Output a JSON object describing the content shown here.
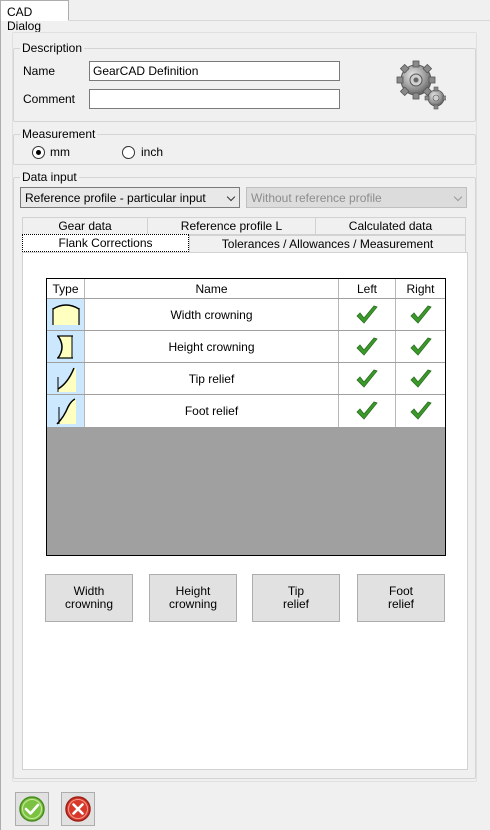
{
  "window": {
    "tab_title": "CAD Dialog"
  },
  "description": {
    "title": "Description",
    "name_label": "Name",
    "name_value": "GearCAD Definition",
    "comment_label": "Comment",
    "comment_value": "",
    "logo_icon": "gears-icon"
  },
  "measurement": {
    "title": "Measurement",
    "options": [
      {
        "label": "mm",
        "checked": true
      },
      {
        "label": "inch",
        "checked": false
      }
    ]
  },
  "data_input": {
    "title": "Data input",
    "profile_select": "Reference profile - particular input",
    "reference_select": "Without reference profile"
  },
  "tabs": {
    "row1": [
      "Gear data",
      "Reference profile L",
      "Calculated data"
    ],
    "row2": [
      "Flank Corrections",
      "Tolerances / Allowances / Measurement"
    ],
    "active": "Flank Corrections"
  },
  "grid": {
    "headers": {
      "type": "Type",
      "name": "Name",
      "left": "Left",
      "right": "Right"
    },
    "rows": [
      {
        "icon": "width-crowning-icon",
        "name": "Width crowning",
        "left": true,
        "right": true
      },
      {
        "icon": "height-crowning-icon",
        "name": "Height crowning",
        "left": true,
        "right": true
      },
      {
        "icon": "tip-relief-icon",
        "name": "Tip relief",
        "left": true,
        "right": true
      },
      {
        "icon": "foot-relief-icon",
        "name": "Foot relief",
        "left": true,
        "right": true
      }
    ]
  },
  "buttons": {
    "width_crowning": "Width\ncrowning",
    "height_crowning": "Height\ncrowning",
    "tip_relief": "Tip\nrelief",
    "foot_relief": "Foot\nrelief"
  },
  "footer": {
    "ok_icon": "ok-check-icon",
    "cancel_icon": "cancel-x-icon"
  },
  "colors": {
    "check_green": "#3a9a2a",
    "cancel_red": "#d8382a",
    "ok_green": "#7cc242",
    "type_cell": "#cce8ff"
  }
}
